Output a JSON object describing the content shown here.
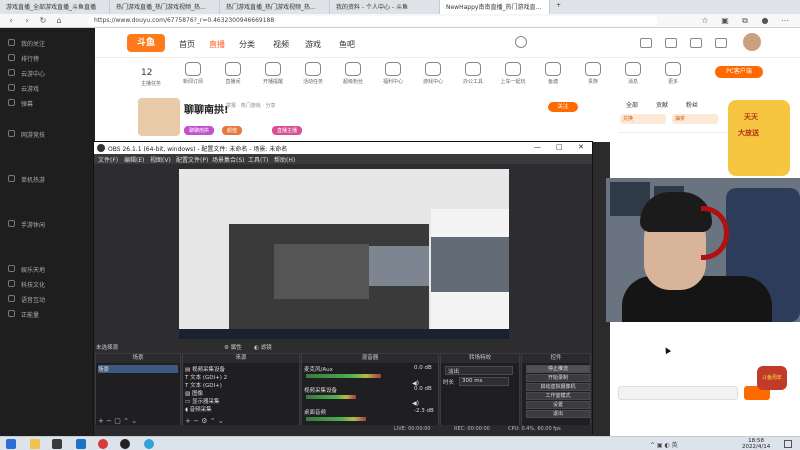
{
  "browser": {
    "tabs": [
      {
        "label": "游戏直播_全部游戏直播_斗鱼直播"
      },
      {
        "label": "热门游戏直播_热门游戏视频_热..."
      },
      {
        "label": "热门游戏直播_热门游戏视频_热..."
      },
      {
        "label": "我的资料 - 个人中心 - 斗鱼"
      },
      {
        "label": "NewHappy南南直播_热门游戏直..."
      }
    ],
    "new_tab": "+",
    "url": "https://www.douyu.com/6775876?_r=0.4632300946669188"
  },
  "topnav": {
    "logo": "斗鱼",
    "links": [
      {
        "label": "首页"
      },
      {
        "label": "直播"
      },
      {
        "label": "分类"
      },
      {
        "label": "视频"
      },
      {
        "label": "游戏"
      },
      {
        "label": "鱼吧"
      }
    ]
  },
  "categories": {
    "count": "12",
    "items": [
      {
        "label": "主播任务"
      },
      {
        "label": "新闻订阅"
      },
      {
        "label": "直播间"
      },
      {
        "label": "开播提醒"
      },
      {
        "label": "活动任务"
      },
      {
        "label": "超级粉丝"
      },
      {
        "label": "福利中心"
      },
      {
        "label": "游戏中心"
      },
      {
        "label": "办公工具"
      },
      {
        "label": "上车一起玩"
      },
      {
        "label": "鱼塘"
      },
      {
        "label": "贵族"
      },
      {
        "label": "消息"
      },
      {
        "label": "更多"
      }
    ],
    "pc_badge": "PC客户端"
  },
  "sidebar": {
    "items": [
      {
        "label": "我的关注"
      },
      {
        "label": "排行榜"
      },
      {
        "label": "云游中心"
      },
      {
        "label": "云游戏"
      },
      {
        "label": "弹幕"
      },
      {
        "label": "网游竞技"
      },
      {
        "label": "单机热游"
      },
      {
        "label": "手游休闲"
      },
      {
        "label": "娱乐天地"
      },
      {
        "label": "科技文化"
      },
      {
        "label": "语音互动"
      },
      {
        "label": "正能量"
      }
    ]
  },
  "room": {
    "title": "聊聊南拱!",
    "info": "举报 · 热门游戏 · 分享",
    "tags": [
      {
        "label": "聊聊南拱",
        "color": "#c34fd1"
      },
      {
        "label": "颜值",
        "color": "#e77a3a"
      },
      {
        "label": "直播主播",
        "color": "#d94f91"
      }
    ],
    "follow_text": "关注",
    "chat_tabs": [
      {
        "label": "全部"
      },
      {
        "label": "贡献"
      },
      {
        "label": "粉丝"
      }
    ],
    "gifts": [
      {
        "label": "兑换"
      },
      {
        "label": "抽奖"
      }
    ],
    "promo_lines": [
      "天天",
      "大放送"
    ]
  },
  "obs": {
    "title": "OBS 26.1.1 (64-bit, windows) - 配置文件: 未命名 - 场景: 未命名",
    "menu": [
      {
        "label": "文件(F)"
      },
      {
        "label": "编辑(E)"
      },
      {
        "label": "视图(V)"
      },
      {
        "label": "配置文件(P)"
      },
      {
        "label": "场景集合(S)"
      },
      {
        "label": "工具(T)"
      },
      {
        "label": "帮助(H)"
      }
    ],
    "window_buttons": [
      "—",
      "□",
      "✕"
    ],
    "strip_text": "未选择源",
    "strip_buttons": [
      {
        "label": "属性"
      },
      {
        "label": "滤镜"
      }
    ],
    "docks": {
      "scenes": {
        "title": "场景",
        "items": [
          {
            "label": "场景",
            "selected": true
          }
        ]
      },
      "sources": {
        "title": "来源",
        "items": [
          {
            "label": "视频采集设备"
          },
          {
            "label": "文本 (GDI+) 2"
          },
          {
            "label": "文本 (GDI+)"
          },
          {
            "label": "图像"
          },
          {
            "label": "显示器采集"
          },
          {
            "label": "音频采集"
          }
        ]
      },
      "mixer": {
        "title": "混音器",
        "channels": [
          {
            "label": "麦克风/Aux",
            "db": "0.0 dB",
            "level": 0.75
          },
          {
            "label": "视频采集设备",
            "db": "0.0 dB",
            "level": 0.5
          },
          {
            "label": "桌面音频",
            "db": "-2.3 dB",
            "level": 0.6
          }
        ]
      },
      "transitions": {
        "title": "转场特效",
        "mode": "淡出",
        "duration_label": "时长",
        "duration": "300 ms"
      },
      "controls": {
        "title": "控件",
        "buttons": [
          {
            "label": "停止推流"
          },
          {
            "label": "开始录制"
          },
          {
            "label": "启动虚拟摄像机"
          },
          {
            "label": "工作室模式"
          },
          {
            "label": "设置"
          },
          {
            "label": "退出"
          }
        ]
      }
    },
    "status": {
      "live": "LIVE: 00:00:00",
      "rec": "REC: 00:00:00",
      "cpu": "CPU: 0.4%, 60.00 fps"
    }
  },
  "taskbar": {
    "time": "18:58",
    "date": "2022/4/14"
  },
  "mascot": "斗鱼周年"
}
